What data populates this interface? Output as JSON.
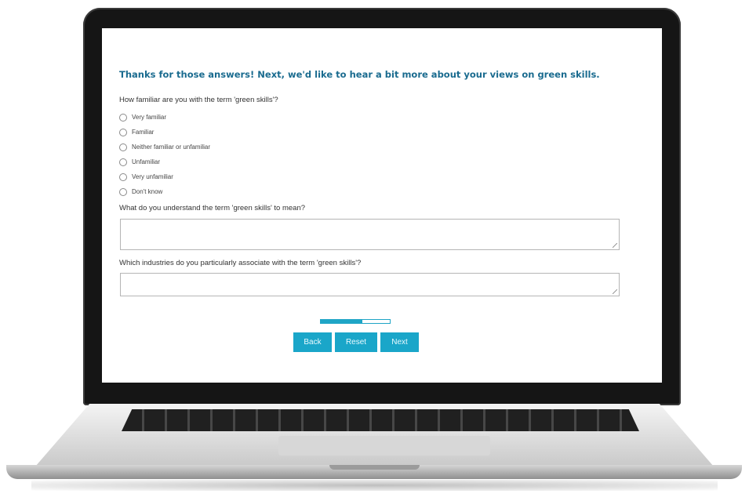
{
  "survey": {
    "heading": "Thanks for those answers! Next, we'd like to hear a bit more about your views on green skills.",
    "q1": {
      "text": "How familiar are you with the term 'green skills'?",
      "options": [
        "Very familiar",
        "Familiar",
        "Neither familiar or unfamiliar",
        "Unfamiliar",
        "Very unfamiliar",
        "Don't know"
      ]
    },
    "q2": {
      "text": "What do you understand the term 'green skills' to mean?",
      "value": ""
    },
    "q3": {
      "text": "Which industries do you particularly associate with the term 'green skills'?",
      "value": ""
    },
    "progress": 0.6,
    "buttons": {
      "back": "Back",
      "reset": "Reset",
      "next": "Next"
    }
  },
  "colors": {
    "accent": "#1aa6c9",
    "heading": "#1a6b8f"
  }
}
